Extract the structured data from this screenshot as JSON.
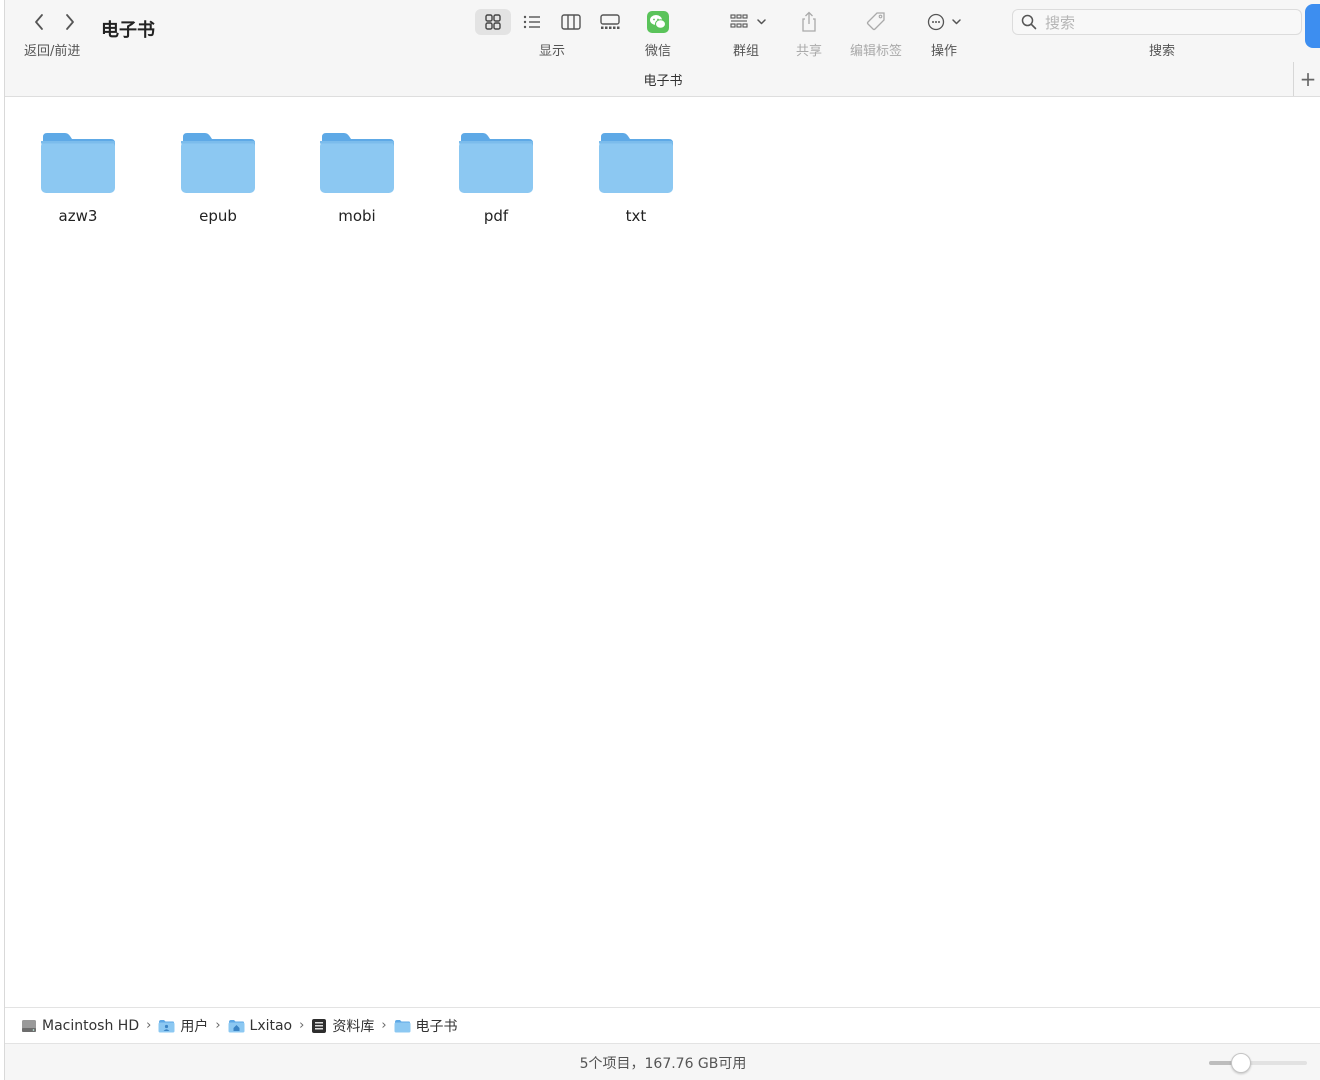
{
  "window": {
    "title": "电子书",
    "path_title": "电子书"
  },
  "toolbar": {
    "nav_label": "返回/前进",
    "view_label": "显示",
    "wechat_label": "微信",
    "group_label": "群组",
    "share_label": "共享",
    "tags_label": "编辑标签",
    "action_label": "操作",
    "search_label": "搜索",
    "search_placeholder": "搜索",
    "selected_view": "icon"
  },
  "icons": {
    "back": "chevron-left-icon",
    "forward": "chevron-right-icon",
    "view_icon": "grid-icon",
    "view_list": "list-icon",
    "view_column": "columns-icon",
    "view_gallery": "gallery-icon",
    "wechat": "wechat-icon",
    "group": "group-icon",
    "share": "share-icon",
    "tag": "tag-icon",
    "action": "ellipsis-circle-icon",
    "search": "search-icon",
    "add": "plus-icon"
  },
  "colors": {
    "folder_body": "#8cc8f2",
    "folder_tab": "#5ea9e6",
    "wechat": "#5ac35a",
    "accent": "#3d8ef0"
  },
  "folders": [
    {
      "name": "azw3"
    },
    {
      "name": "epub"
    },
    {
      "name": "mobi"
    },
    {
      "name": "pdf"
    },
    {
      "name": "txt"
    }
  ],
  "pathbar": {
    "items": [
      {
        "label": "Macintosh HD",
        "icon": "drive-icon"
      },
      {
        "label": "用户",
        "icon": "users-folder-icon"
      },
      {
        "label": "Lxitao",
        "icon": "home-folder-icon"
      },
      {
        "label": "资料库",
        "icon": "library-icon"
      },
      {
        "label": "电子书",
        "icon": "folder-icon"
      }
    ],
    "separator": "›"
  },
  "status": {
    "text": "5个项目，167.76 GB可用",
    "zoom_fraction": 0.27
  }
}
